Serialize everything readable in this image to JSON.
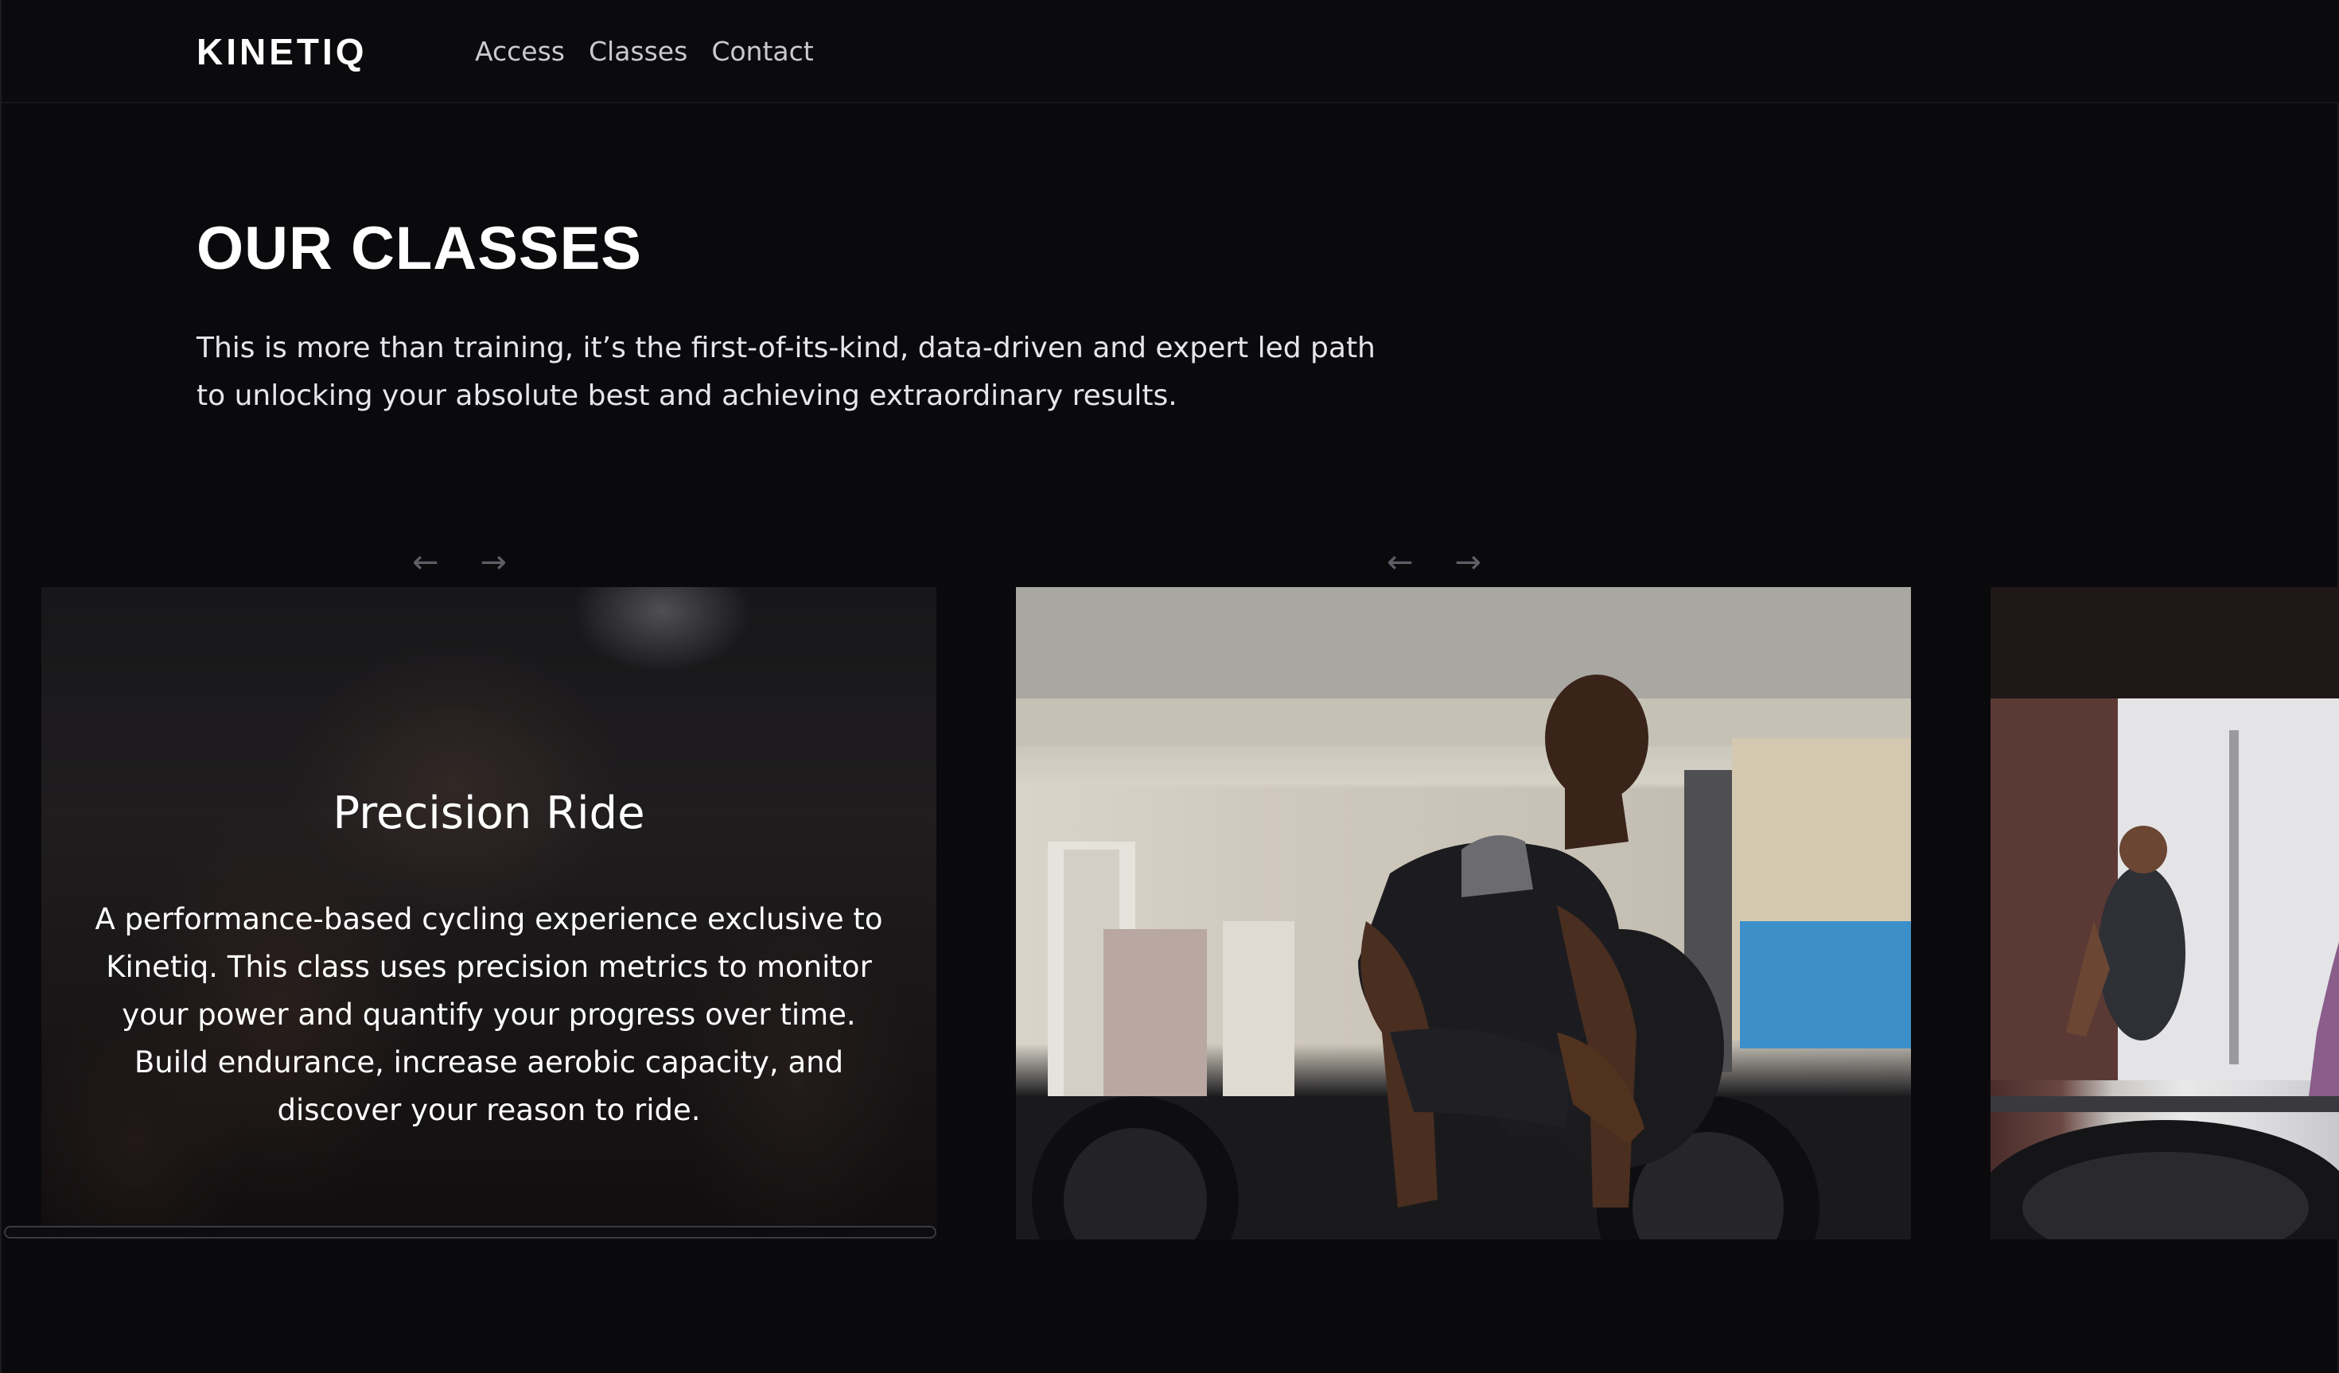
{
  "header": {
    "logo": "KINETIQ",
    "nav": [
      "Access",
      "Classes",
      "Contact"
    ]
  },
  "hero": {
    "title": "OUR CLASSES",
    "intro": "This is more than training, it’s the first-of-its-kind, data-driven and expert led path to unlocking your absolute best and achieving extraordinary results."
  },
  "carousel": {
    "prev_icon": "←",
    "next_icon": "→",
    "cards": [
      {
        "title": "Precision Ride",
        "description": "A performance-based cycling experience exclusive to Kinetiq. This class uses precision metrics to monitor your power and quantify your progress over time. Build endurance, increase aerobic capacity, and discover your reason to ride."
      }
    ]
  },
  "colors": {
    "background": "#0a0a0d",
    "text": "#ffffff",
    "nav_text": "#c9c9cf",
    "arrow": "#5e5e66"
  }
}
